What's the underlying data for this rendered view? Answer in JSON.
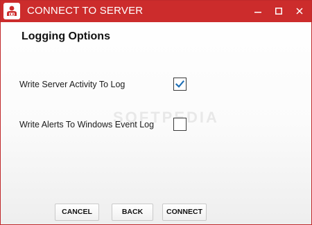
{
  "window": {
    "title": "CONNECT TO SERVER",
    "minimize_glyph": "—",
    "maximize_glyph": "☐",
    "close_glyph": "✕"
  },
  "page": {
    "heading": "Logging Options"
  },
  "options": [
    {
      "label": "Write Server Activity To Log",
      "checked": true
    },
    {
      "label": "Write Alerts To Windows Event Log",
      "checked": false
    }
  ],
  "buttons": {
    "cancel": "CANCEL",
    "back": "BACK",
    "connect": "CONNECT"
  },
  "watermark": "SOFTPEDIA",
  "colors": {
    "titlebar": "#cc2c2c",
    "checkmark": "#1e6fb5"
  },
  "icons": {
    "app": "server-user-icon",
    "minimize": "minimize-icon",
    "maximize": "maximize-icon",
    "close": "close-icon",
    "check": "checkmark-icon"
  }
}
